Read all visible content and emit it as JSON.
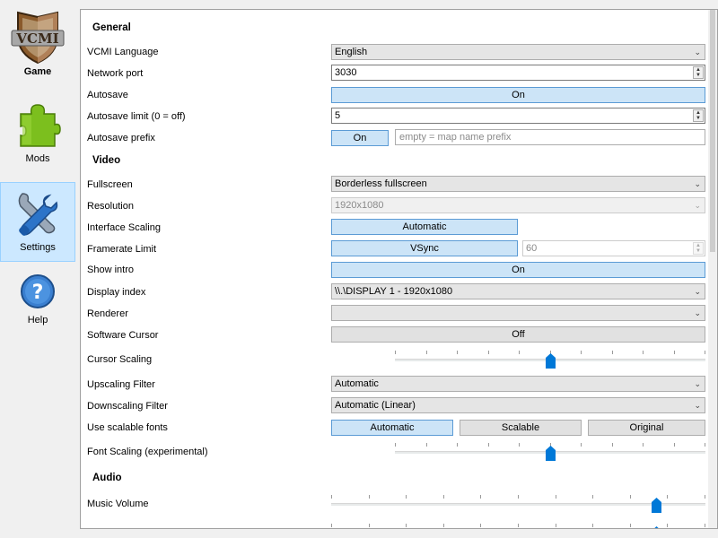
{
  "nav": {
    "items": [
      {
        "label": "Game"
      },
      {
        "label": "Mods"
      },
      {
        "label": "Settings"
      },
      {
        "label": "Help"
      }
    ],
    "logo_text": "VCMI"
  },
  "colors": {
    "accent": "#0078d7",
    "selected_bg": "#cce8ff",
    "toggle_on_bg": "#cce4f7"
  },
  "general": {
    "title": "General",
    "language_label": "VCMI Language",
    "language_value": "English",
    "port_label": "Network port",
    "port_value": "3030",
    "autosave_label": "Autosave",
    "autosave_value": "On",
    "autosave_limit_label": "Autosave limit (0 = off)",
    "autosave_limit_value": "5",
    "autosave_prefix_label": "Autosave prefix",
    "autosave_prefix_toggle": "On",
    "autosave_prefix_placeholder": "empty = map name prefix"
  },
  "video": {
    "title": "Video",
    "fullscreen_label": "Fullscreen",
    "fullscreen_value": "Borderless fullscreen",
    "resolution_label": "Resolution",
    "resolution_value": "1920x1080",
    "interface_scaling_label": "Interface Scaling",
    "interface_scaling_value": "Automatic",
    "framerate_label": "Framerate Limit",
    "framerate_toggle": "VSync",
    "framerate_value": "60",
    "show_intro_label": "Show intro",
    "show_intro_value": "On",
    "display_index_label": "Display index",
    "display_index_value": "\\\\.\\DISPLAY 1 - 1920x1080",
    "renderer_label": "Renderer",
    "renderer_value": "",
    "software_cursor_label": "Software Cursor",
    "software_cursor_value": "Off",
    "cursor_scaling_label": "Cursor Scaling",
    "cursor_scaling_level": 0.5,
    "upscaling_label": "Upscaling Filter",
    "upscaling_value": "Automatic",
    "downscaling_label": "Downscaling Filter",
    "downscaling_value": "Automatic (Linear)",
    "scalable_fonts_label": "Use scalable fonts",
    "scalable_fonts_options": [
      "Automatic",
      "Scalable",
      "Original"
    ],
    "scalable_fonts_selected": 0,
    "font_scaling_label": "Font Scaling (experimental)",
    "font_scaling_level": 0.5
  },
  "audio": {
    "title": "Audio",
    "music_volume_label": "Music Volume",
    "music_volume_level": 0.88
  }
}
